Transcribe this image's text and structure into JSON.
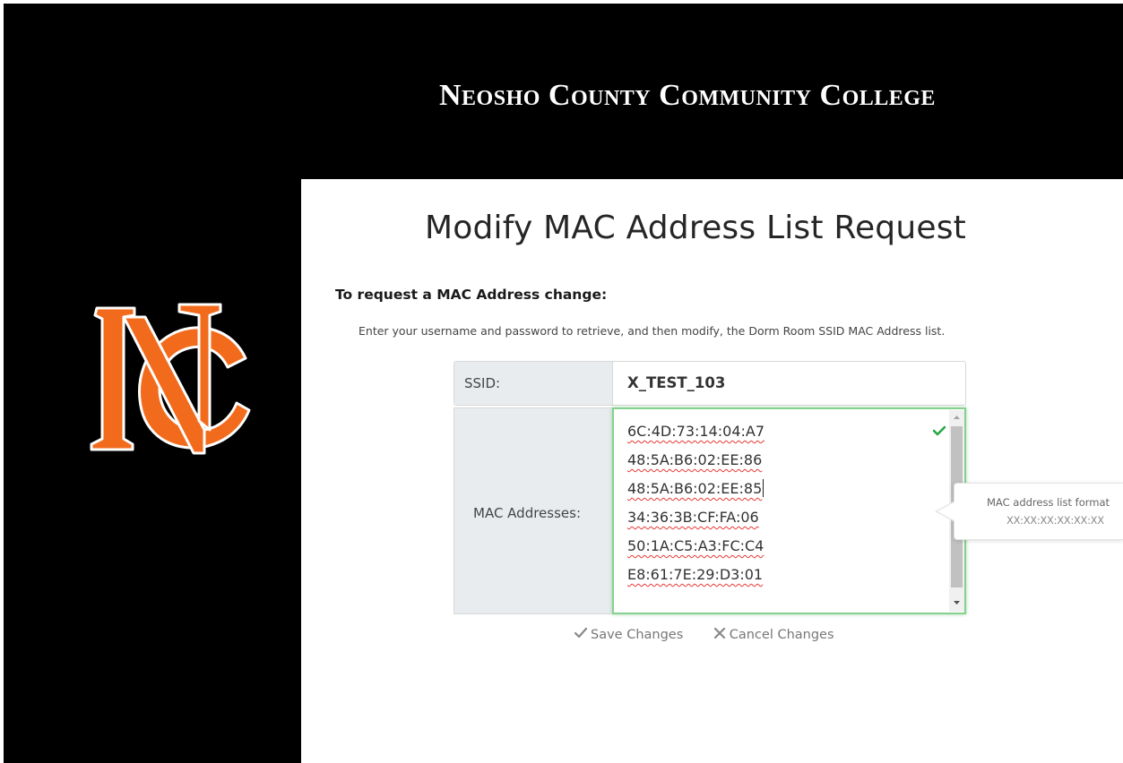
{
  "header": {
    "college_name": "Neosho County Community College"
  },
  "logo": {
    "icon": "nc-monogram-logo",
    "letters": "NC",
    "colors": {
      "primary": "#f26b1d",
      "outline": "#ffffff",
      "background": "#000000"
    }
  },
  "page": {
    "title": "Modify MAC Address List Request",
    "section_heading": "To request a MAC Address change:",
    "instructions": "Enter your username and password to retrieve, and then modify, the Dorm Room SSID MAC Address list."
  },
  "form": {
    "ssid_label": "SSID:",
    "ssid_value": "X_TEST_103",
    "mac_label": "MAC Addresses:",
    "mac_addresses": [
      "6C:4D:73:14:04:A7",
      "48:5A:B6:02:EE:86",
      "48:5A:B6:02:EE:85",
      "34:36:3B:CF:FA:06",
      "50:1A:C5:A3:FC:C4",
      "E8:61:7E:29:D3:01"
    ],
    "valid_icon": "checkmark-icon",
    "valid_color": "#28a745"
  },
  "tooltip": {
    "title": "MAC address list format",
    "format": "XX:XX:XX:XX:XX:XX"
  },
  "actions": {
    "save_label": "Save Changes",
    "save_icon": "checkmark-icon",
    "cancel_label": "Cancel Changes",
    "cancel_icon": "x-icon"
  }
}
